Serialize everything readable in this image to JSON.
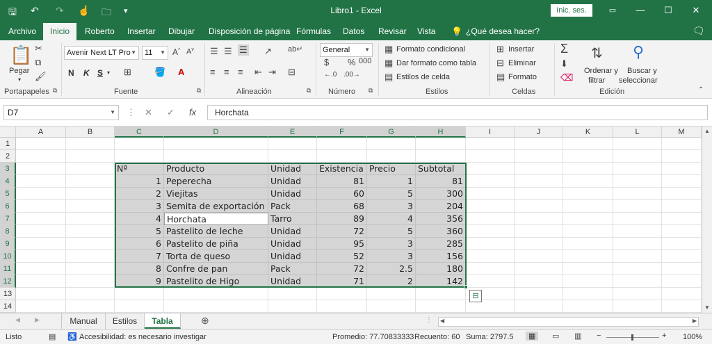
{
  "window": {
    "title": "Libro1  -  Excel",
    "signin": "Inic. ses.",
    "minimize": "—",
    "restore": "☐",
    "close": "✕"
  },
  "menu": {
    "tabs": [
      "Archivo",
      "Inicio",
      "Roberto",
      "Insertar",
      "Dibujar",
      "Disposición de página",
      "Fórmulas",
      "Datos",
      "Revisar",
      "Vista"
    ],
    "active": "Inicio",
    "help": "¿Qué desea hacer?"
  },
  "ribbon": {
    "clipboard": {
      "paste": "Pegar",
      "label": "Portapapeles"
    },
    "font": {
      "name": "Avenir Next LT Pro",
      "size": "11",
      "bold": "N",
      "italic": "K",
      "underline": "S",
      "label": "Fuente"
    },
    "alignment": {
      "label": "Alineación"
    },
    "number": {
      "format": "General",
      "label": "Número"
    },
    "styles": {
      "conditional": "Formato condicional",
      "table": "Dar formato como tabla",
      "cell": "Estilos de celda",
      "label": "Estilos"
    },
    "cells": {
      "insert": "Insertar",
      "delete": "Eliminar",
      "format": "Formato",
      "label": "Celdas"
    },
    "editing": {
      "sort1": "Ordenar y",
      "sort2": "filtrar",
      "find1": "Buscar y",
      "find2": "seleccionar",
      "label": "Edición"
    }
  },
  "formula_bar": {
    "name_box": "D7",
    "fx": "fx",
    "value": "Horchata"
  },
  "grid": {
    "columns": [
      "A",
      "B",
      "C",
      "D",
      "E",
      "F",
      "G",
      "H",
      "I",
      "J",
      "K",
      "L",
      "M"
    ],
    "rows": [
      "1",
      "2",
      "3",
      "4",
      "5",
      "6",
      "7",
      "8",
      "9",
      "10",
      "11",
      "12",
      "13",
      "14"
    ],
    "header": [
      "Nº",
      "Producto",
      "Unidad",
      "Existencia",
      "Precio",
      "Subtotal"
    ],
    "data": [
      [
        "1",
        "Peperecha",
        "Unidad",
        "81",
        "1",
        "81"
      ],
      [
        "2",
        "Viejitas",
        "Unidad",
        "60",
        "5",
        "300"
      ],
      [
        "3",
        "Semita de exportación",
        "Pack",
        "68",
        "3",
        "204"
      ],
      [
        "4",
        "Horchata",
        "Tarro",
        "89",
        "4",
        "356"
      ],
      [
        "5",
        "Pastelito de leche",
        "Unidad",
        "72",
        "5",
        "360"
      ],
      [
        "6",
        "Pastelito de piña",
        "Unidad",
        "95",
        "3",
        "285"
      ],
      [
        "7",
        "Torta de queso",
        "Unidad",
        "52",
        "3",
        "156"
      ],
      [
        "8",
        "Confre de pan",
        "Pack",
        "72",
        "2.5",
        "180"
      ],
      [
        "9",
        "Pastelito de Higo",
        "Unidad",
        "71",
        "2",
        "142"
      ]
    ]
  },
  "sheets": {
    "tabs": [
      "Manual",
      "Estilos",
      "Tabla"
    ],
    "active": "Tabla"
  },
  "status": {
    "ready": "Listo",
    "accessibility": "Accesibilidad: es necesario investigar",
    "average": "Promedio: 77.70833333",
    "count": "Recuento: 60",
    "sum": "Suma: 2797.5",
    "zoom": "100%"
  }
}
